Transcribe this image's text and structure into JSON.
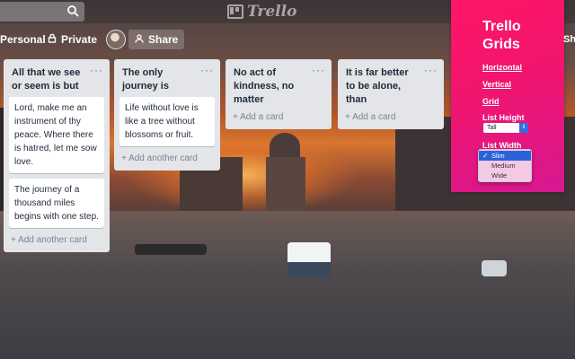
{
  "header": {
    "logo_text": "Trello",
    "team_label": "Personal",
    "privacy_label": "Private",
    "share_label": "Share"
  },
  "lists": [
    {
      "title": "All that we see or seem is but",
      "cards": [
        "Lord, make me an instrument of thy peace. Where there is hatred, let me sow love.",
        "The journey of a thousand miles begins with one step."
      ],
      "add_label": "+ Add another card"
    },
    {
      "title": "The only journey is",
      "cards": [
        "Life without love is like a tree without blossoms or fruit."
      ],
      "add_label": "+ Add another card"
    },
    {
      "title": "No act of kindness, no matter",
      "cards": [],
      "add_label": "+ Add a card"
    },
    {
      "title": "It is far better to be alone, than",
      "cards": [],
      "add_label": "+ Add a card"
    }
  ],
  "popup": {
    "title_line1": "Trello",
    "title_line2": "Grids",
    "links": [
      "Horizontal",
      "Vertical",
      "Grid"
    ],
    "list_height_label": "List Height",
    "list_height_value": "Tall",
    "list_width_label": "List Width",
    "width_options": [
      "Slim",
      "Medium",
      "Wide"
    ],
    "width_selected": "Slim"
  },
  "edge_share_fragment": "Sh",
  "icons": {
    "search": "search-icon",
    "lock": "lock-icon",
    "share": "share-icon",
    "menu": "ellipsis-icon"
  }
}
